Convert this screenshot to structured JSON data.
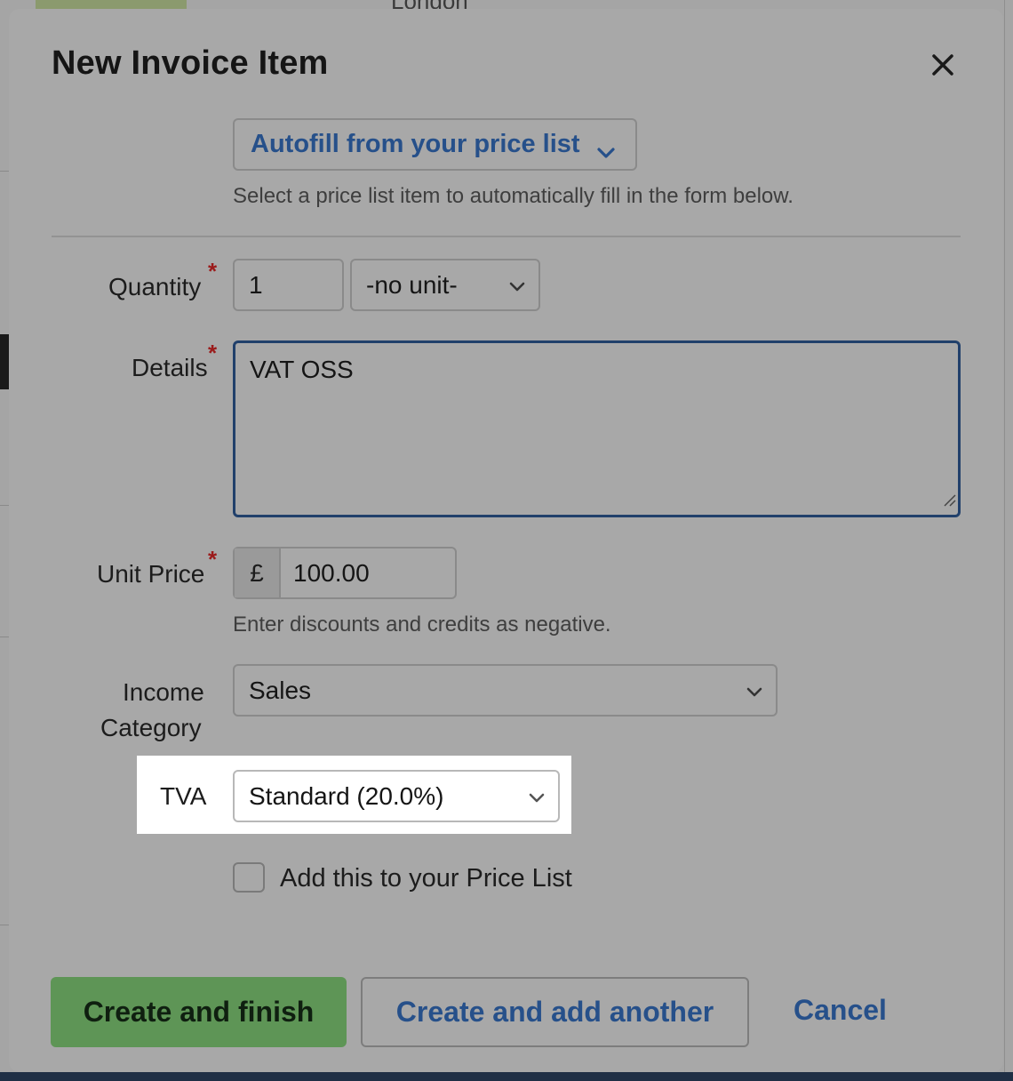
{
  "background": {
    "top_text": "London"
  },
  "modal": {
    "title": "New Invoice Item",
    "close_icon": "close-icon",
    "autofill": {
      "label": "Autofill from your price list",
      "help": "Select a price list item to automatically fill in the form below."
    },
    "quantity": {
      "label": "Quantity",
      "value": "1",
      "unit": "-no unit-"
    },
    "details": {
      "label": "Details",
      "value": "VAT OSS"
    },
    "unit_price": {
      "label": "Unit Price",
      "currency": "£",
      "value": "100.00",
      "help": "Enter discounts and credits as negative."
    },
    "income_category": {
      "label_line1": "Income",
      "label_line2": "Category",
      "value": "Sales"
    },
    "tva": {
      "label": "TVA",
      "value": "Standard (20.0%)"
    },
    "price_list_checkbox": {
      "label": "Add this to your Price List",
      "checked": false
    },
    "buttons": {
      "create_finish": "Create and finish",
      "create_another": "Create and add another",
      "cancel": "Cancel"
    }
  },
  "colors": {
    "primary_button": "#5e9556",
    "link_blue": "#26508a",
    "required_star": "#9b1b1b",
    "focus_border": "#21406b"
  }
}
